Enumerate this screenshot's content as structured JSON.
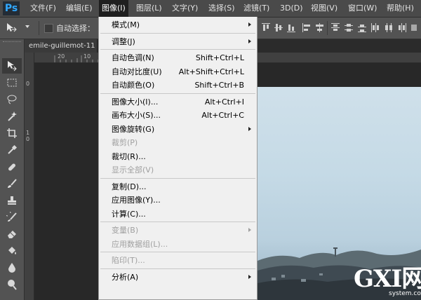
{
  "app": {
    "logo": "Ps"
  },
  "menubar": {
    "items": [
      {
        "label": "文件(F)"
      },
      {
        "label": "编辑(E)"
      },
      {
        "label": "图像(I)"
      },
      {
        "label": "图层(L)"
      },
      {
        "label": "文字(Y)"
      },
      {
        "label": "选择(S)"
      },
      {
        "label": "滤镜(T)"
      },
      {
        "label": "3D(D)"
      },
      {
        "label": "视图(V)"
      },
      {
        "label": "窗口(W)"
      },
      {
        "label": "帮助(H)"
      }
    ],
    "active_index": 2
  },
  "options_bar": {
    "tool_preset_icon": "move-tool-icon",
    "auto_select_label": "自动选择：",
    "auto_select_checked": false
  },
  "document": {
    "tab_title": "emile-guillemot-11",
    "ruler_h_labels": [
      "20",
      "10"
    ],
    "ruler_v_labels": [
      "0",
      "1",
      "0"
    ]
  },
  "image_menu": {
    "items": [
      {
        "label": "模式(M)",
        "shortcut": "",
        "submenu": true,
        "disabled": false
      },
      {
        "separator": true
      },
      {
        "label": "调整(J)",
        "shortcut": "",
        "submenu": true,
        "disabled": false
      },
      {
        "separator": true
      },
      {
        "label": "自动色调(N)",
        "shortcut": "Shift+Ctrl+L",
        "submenu": false,
        "disabled": false
      },
      {
        "label": "自动对比度(U)",
        "shortcut": "Alt+Shift+Ctrl+L",
        "submenu": false,
        "disabled": false
      },
      {
        "label": "自动颜色(O)",
        "shortcut": "Shift+Ctrl+B",
        "submenu": false,
        "disabled": false
      },
      {
        "separator": true
      },
      {
        "label": "图像大小(I)...",
        "shortcut": "Alt+Ctrl+I",
        "submenu": false,
        "disabled": false
      },
      {
        "label": "画布大小(S)...",
        "shortcut": "Alt+Ctrl+C",
        "submenu": false,
        "disabled": false
      },
      {
        "label": "图像旋转(G)",
        "shortcut": "",
        "submenu": true,
        "disabled": false
      },
      {
        "label": "裁剪(P)",
        "shortcut": "",
        "submenu": false,
        "disabled": true
      },
      {
        "label": "裁切(R)...",
        "shortcut": "",
        "submenu": false,
        "disabled": false
      },
      {
        "label": "显示全部(V)",
        "shortcut": "",
        "submenu": false,
        "disabled": true
      },
      {
        "separator": true
      },
      {
        "label": "复制(D)...",
        "shortcut": "",
        "submenu": false,
        "disabled": false
      },
      {
        "label": "应用图像(Y)...",
        "shortcut": "",
        "submenu": false,
        "disabled": false
      },
      {
        "label": "计算(C)...",
        "shortcut": "",
        "submenu": false,
        "disabled": false
      },
      {
        "separator": true
      },
      {
        "label": "变量(B)",
        "shortcut": "",
        "submenu": true,
        "disabled": true
      },
      {
        "label": "应用数据组(L)...",
        "shortcut": "",
        "submenu": false,
        "disabled": true
      },
      {
        "separator": true
      },
      {
        "label": "陷印(T)...",
        "shortcut": "",
        "submenu": false,
        "disabled": true
      },
      {
        "separator": true
      },
      {
        "label": "分析(A)",
        "shortcut": "",
        "submenu": true,
        "disabled": false
      }
    ]
  },
  "toolbar": {
    "tools": [
      "move-tool-icon",
      "marquee-tool-icon",
      "lasso-tool-icon",
      "magic-wand-tool-icon",
      "crop-tool-icon",
      "eyedropper-tool-icon",
      "healing-brush-tool-icon",
      "brush-tool-icon",
      "clone-stamp-tool-icon",
      "history-brush-tool-icon",
      "eraser-tool-icon",
      "paint-bucket-tool-icon",
      "blur-tool-icon",
      "dodge-tool-icon"
    ],
    "selected_index": 0
  },
  "watermark": {
    "text": "GXI网",
    "subtext": "system.com"
  },
  "colors": {
    "menubar_bg": "#4a4a4a",
    "panel_bg": "#535353",
    "canvas_bg": "#282828",
    "menu_bg": "#f0f0f0",
    "menu_disabled_text": "#a0a0a0",
    "ps_logo_blue": "#31a8ff"
  }
}
